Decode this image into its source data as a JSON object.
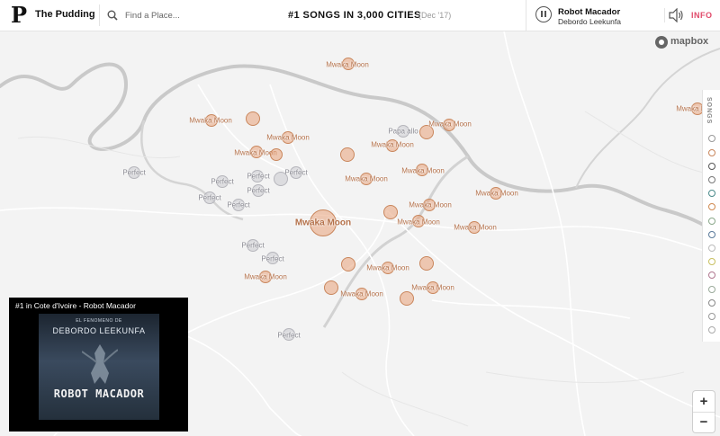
{
  "header": {
    "brand": "The Pudding",
    "search_placeholder": "Find a Place...",
    "title": "#1 SONGS IN 3,000 CITIES",
    "date": "(Dec '17)",
    "now_playing": {
      "title": "Robot Macador",
      "artist": "Debordo Leekunfa"
    },
    "info_label": "INFO"
  },
  "map": {
    "attribution": "mapbox",
    "labels": {
      "mwaka": "Mwaka Moon",
      "perfect": "Perfect",
      "papa": "Papa allo"
    }
  },
  "songs_panel": {
    "label": "SONGS"
  },
  "video": {
    "title": "#1 in Cote d'Ivoire - Robot Macador",
    "artist_text": "DEBORDO LEEKUNFA",
    "header_text": "EL FENOMENO DE",
    "song_text": "ROBOT MACADOR"
  },
  "zoom": {
    "in_label": "+",
    "out_label": "−"
  },
  "colors": {
    "mwaka": "#e8a078",
    "perfect": "#c8c8cc",
    "info": "#e04a6a"
  }
}
